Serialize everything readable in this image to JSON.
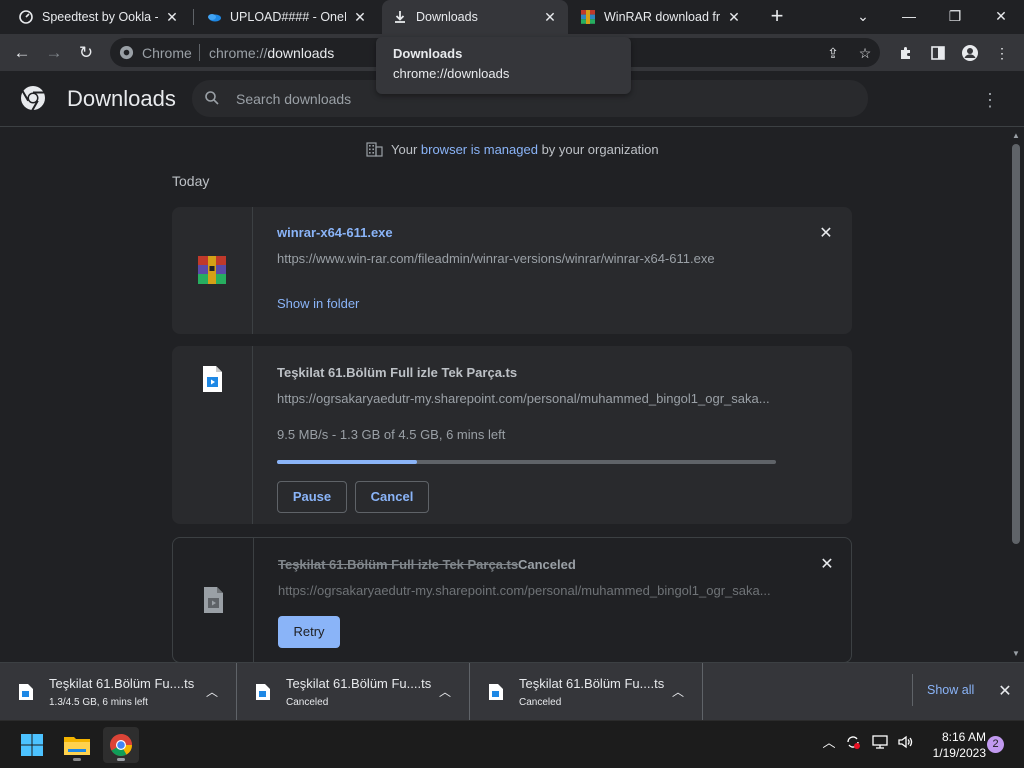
{
  "tabs": [
    {
      "title": "Speedtest by Ookla - T",
      "icon": "speedtest-icon",
      "active": false
    },
    {
      "title": "UPLOAD#### - OneDri",
      "icon": "onedrive-icon",
      "active": false
    },
    {
      "title": "Downloads",
      "icon": "download-icon",
      "active": true
    },
    {
      "title": "WinRAR download free",
      "icon": "winrar-icon",
      "active": false
    }
  ],
  "omnibox": {
    "chip": "Chrome",
    "url_prefix": "chrome://",
    "url_host": "downloads"
  },
  "tooltip": {
    "title": "Downloads",
    "url": "chrome://downloads"
  },
  "header": {
    "title": "Downloads",
    "search_placeholder": "Search downloads"
  },
  "managed": {
    "prefix": "Your ",
    "link": "browser is managed",
    "suffix": " by your organization"
  },
  "section": {
    "today": "Today"
  },
  "downloads": [
    {
      "name": "winrar-x64-611.exe",
      "url": "https://www.win-rar.com/fileadmin/winrar-versions/winrar/winrar-x64-611.exe",
      "action": "Show in folder"
    },
    {
      "name": "Teşkilat 61.Bölüm Full izle Tek Parça.ts",
      "url": "https://ogrsakaryaedutr-my.sharepoint.com/personal/muhammed_bingol1_ogr_saka...",
      "status": "9.5 MB/s - 1.3 GB of 4.5 GB, 6 mins left",
      "progress": 0.28,
      "pause": "Pause",
      "cancel": "Cancel"
    },
    {
      "name": "Teşkilat 61.Bölüm Full izle Tek Parça.ts",
      "state": "Canceled",
      "url": "https://ogrsakaryaedutr-my.sharepoint.com/personal/muhammed_bingol1_ogr_saka...",
      "retry": "Retry"
    }
  ],
  "shelf": {
    "items": [
      {
        "name": "Teşkilat 61.Bölüm Fu....ts",
        "status": "1.3/4.5 GB, 6 mins left"
      },
      {
        "name": "Teşkilat 61.Bölüm Fu....ts",
        "status": "Canceled"
      },
      {
        "name": "Teşkilat 61.Bölüm Fu....ts",
        "status": "Canceled"
      }
    ],
    "show_all": "Show all"
  },
  "taskbar": {
    "time": "8:16 AM",
    "date": "1/19/2023",
    "notifications": "2"
  },
  "colors": {
    "accent": "#8ab4f8",
    "background": "#202124",
    "surface": "#292a2d"
  }
}
